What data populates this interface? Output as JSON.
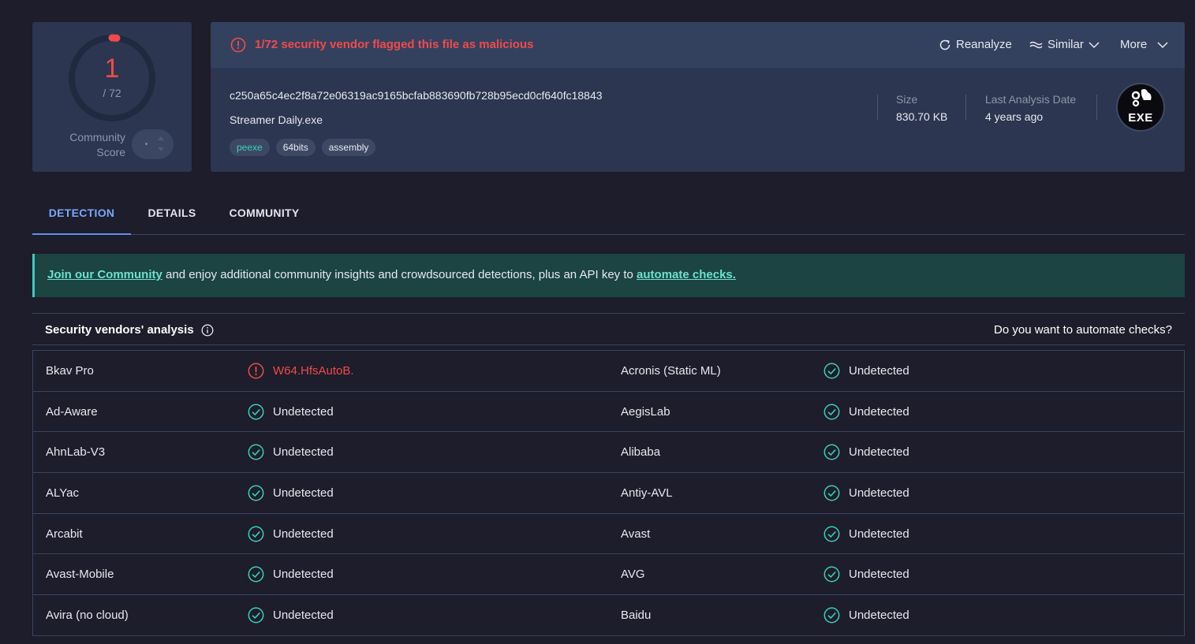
{
  "score": {
    "detections": "1",
    "total": "/ 72",
    "community_label_line1": "Community",
    "community_label_line2": "Score"
  },
  "alert": {
    "text": "1/72 security vendor flagged this file as malicious"
  },
  "actions": {
    "reanalyze": "Reanalyze",
    "similar": "Similar",
    "more": "More"
  },
  "file": {
    "hash": "c250a65c4ec2f8a72e06319ac9165bcfab883690fb728b95ecd0cf640fc18843",
    "name": "Streamer Daily.exe",
    "tags": [
      "peexe",
      "64bits",
      "assembly"
    ],
    "size_label": "Size",
    "size_value": "830.70 KB",
    "date_label": "Last Analysis Date",
    "date_value": "4 years ago",
    "type_icon_text": "EXE"
  },
  "tabs": [
    "DETECTION",
    "DETAILS",
    "COMMUNITY"
  ],
  "banner": {
    "link1": "Join our Community",
    "middle": " and enjoy additional community insights and crowdsourced detections, plus an API key to ",
    "link2": "automate checks."
  },
  "vendors": {
    "title": "Security vendors' analysis",
    "right": "Do you want to automate checks?",
    "rows": [
      [
        {
          "vendor": "Bkav Pro",
          "result": "W64.HfsAutoB.",
          "status": "malicious"
        },
        {
          "vendor": "Acronis (Static ML)",
          "result": "Undetected",
          "status": "clean"
        }
      ],
      [
        {
          "vendor": "Ad-Aware",
          "result": "Undetected",
          "status": "clean"
        },
        {
          "vendor": "AegisLab",
          "result": "Undetected",
          "status": "clean"
        }
      ],
      [
        {
          "vendor": "AhnLab-V3",
          "result": "Undetected",
          "status": "clean"
        },
        {
          "vendor": "Alibaba",
          "result": "Undetected",
          "status": "clean"
        }
      ],
      [
        {
          "vendor": "ALYac",
          "result": "Undetected",
          "status": "clean"
        },
        {
          "vendor": "Antiy-AVL",
          "result": "Undetected",
          "status": "clean"
        }
      ],
      [
        {
          "vendor": "Arcabit",
          "result": "Undetected",
          "status": "clean"
        },
        {
          "vendor": "Avast",
          "result": "Undetected",
          "status": "clean"
        }
      ],
      [
        {
          "vendor": "Avast-Mobile",
          "result": "Undetected",
          "status": "clean"
        },
        {
          "vendor": "AVG",
          "result": "Undetected",
          "status": "clean"
        }
      ],
      [
        {
          "vendor": "Avira (no cloud)",
          "result": "Undetected",
          "status": "clean"
        },
        {
          "vendor": "Baidu",
          "result": "Undetected",
          "status": "clean"
        }
      ]
    ]
  },
  "colors": {
    "malicious": "#ef4b4b",
    "clean": "#3ad0b6",
    "accent": "#7aa7ff"
  }
}
